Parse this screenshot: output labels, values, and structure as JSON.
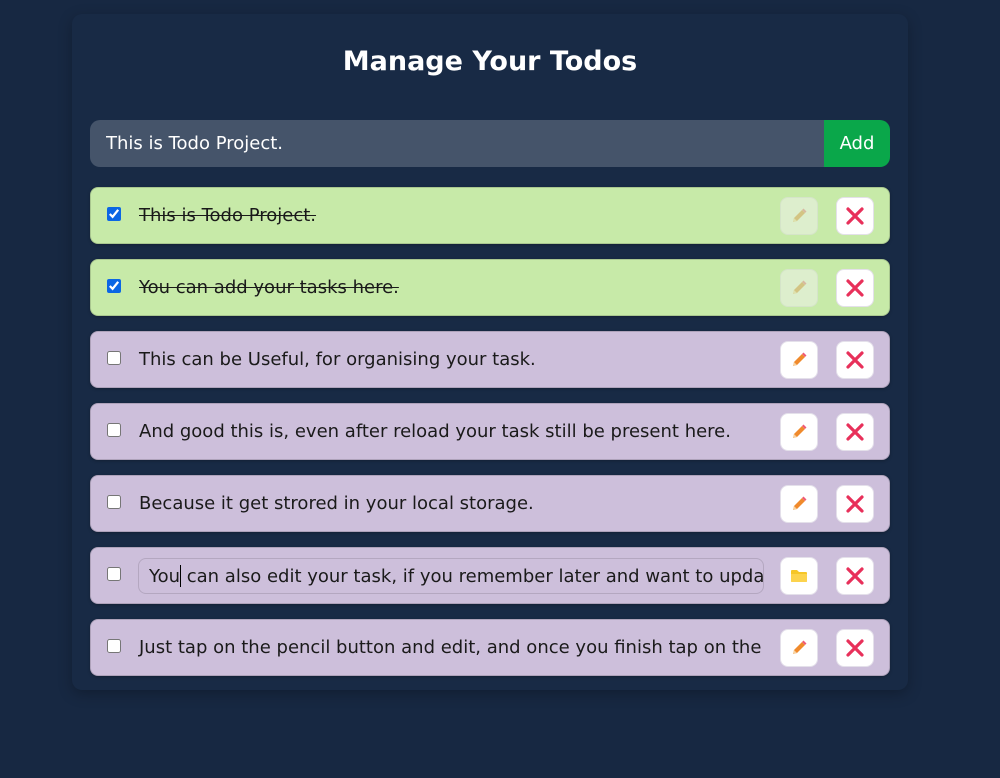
{
  "header": {
    "title": "Manage Your Todos"
  },
  "form": {
    "input_value": "This is Todo Project.",
    "add_label": "Add"
  },
  "todos": [
    {
      "text": "This is Todo Project.",
      "completed": true,
      "editing": false
    },
    {
      "text": "You can add your tasks here.",
      "completed": true,
      "editing": false
    },
    {
      "text": "This can be Useful, for organising your task.",
      "completed": false,
      "editing": false
    },
    {
      "text": "And good this is, even after reload your task still be present here.",
      "completed": false,
      "editing": false
    },
    {
      "text": "Because it get strored in your local storage.",
      "completed": false,
      "editing": false
    },
    {
      "text_before_caret": "You",
      "text_after_caret": " can also edit your task, if you remember later and want to updat",
      "completed": false,
      "editing": true
    },
    {
      "text": "Just tap on the pencil button and edit, and once you finish tap on the fi",
      "completed": false,
      "editing": false
    }
  ],
  "icons": {
    "edit": "pencil-icon",
    "save": "folder-icon",
    "delete": "close-icon"
  },
  "colors": {
    "background": "#172842",
    "input": "#45546a",
    "add_button": "#0aa74a",
    "completed_row": "#c7eaa8",
    "open_row": "#cdbfdb",
    "delete_x": "#e8305a",
    "pencil": "#f08a2c",
    "folder": "#f6c628"
  }
}
